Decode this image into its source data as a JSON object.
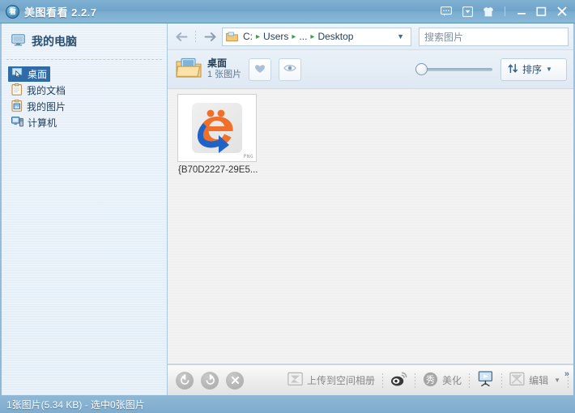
{
  "window": {
    "title": "美图看看 2.2.7",
    "logo_icon": "app-logo-icon",
    "buttons": {
      "feedback": "chat-bubble-icon",
      "dropdown": "box-dropdown-icon",
      "skin": "shirt-skin-icon",
      "minimize": "—",
      "maximize": "❐",
      "close": "✕"
    }
  },
  "sidebar": {
    "header": {
      "label": "我的电脑",
      "icon": "monitor-icon"
    },
    "items": [
      {
        "label": "桌面",
        "icon": "desktop-icon",
        "selected": true
      },
      {
        "label": "我的文档",
        "icon": "documents-icon",
        "selected": false
      },
      {
        "label": "我的图片",
        "icon": "pictures-icon",
        "selected": false
      },
      {
        "label": "计算机",
        "icon": "computer-icon",
        "selected": false
      }
    ]
  },
  "nav": {
    "back_icon": "arrow-left-icon",
    "forward_icon": "arrow-right-icon",
    "breadcrumb": {
      "folder_icon": "folder-icon",
      "parts": [
        "C:",
        "Users",
        "...",
        "Desktop"
      ],
      "separator": "▸",
      "caret": "▼"
    },
    "search": {
      "placeholder": "搜索图片",
      "value": ""
    }
  },
  "folder": {
    "icon": "open-folder-icon",
    "name": "桌面",
    "count": "1 张图片",
    "favorite_icon": "heart-icon",
    "preview_icon": "eye-icon",
    "zoom_slider": {
      "value": 0,
      "min": 0,
      "max": 100
    },
    "sort": {
      "label": "排序",
      "icon": "sort-icon",
      "caret": "▼"
    }
  },
  "files": [
    {
      "name": "{B70D2227-29E5...",
      "format_badge": "PNG",
      "thumb_icon": "ie-logo-thumbnail"
    }
  ],
  "bottom_toolbar": {
    "rotate_left": {
      "icon": "rotate-left-icon",
      "glyph": "↺"
    },
    "rotate_right": {
      "icon": "rotate-right-icon",
      "glyph": "↻"
    },
    "delete": {
      "icon": "close-x-icon",
      "glyph": "✕"
    },
    "items": [
      {
        "label": "上传到空间相册",
        "icon": "upload-album-icon"
      },
      {
        "label": "",
        "icon": "weibo-icon"
      },
      {
        "label": "美化",
        "icon": "beautify-xiu-icon"
      },
      {
        "label": "",
        "icon": "slideshow-icon"
      },
      {
        "label": "编辑",
        "icon": "edit-icon",
        "caret": "▼"
      }
    ],
    "overflow": "»"
  },
  "statusbar": {
    "text": "1张图片(5.34 KB) - 选中0张图片"
  },
  "colors": {
    "titlebar": "#7fb0d2",
    "accent": "#2f6ba8",
    "sidebar_bg": "#e8f1f8",
    "status_bg": "#8fb8d6"
  }
}
